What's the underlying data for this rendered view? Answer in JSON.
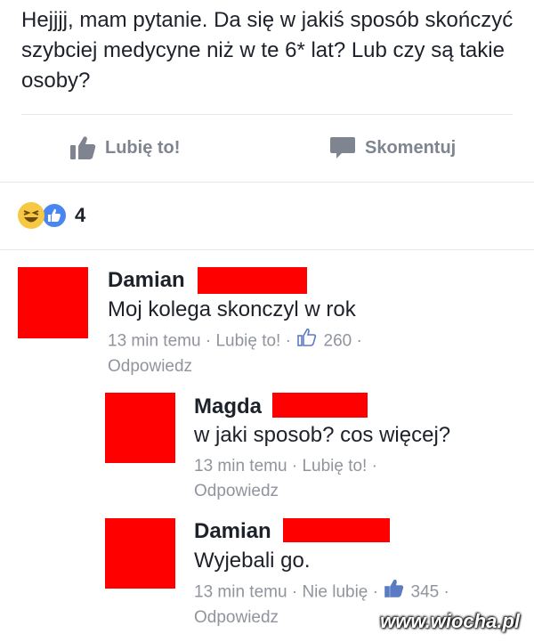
{
  "post": {
    "text": "Hejjjj, mam pytanie. Da się w jakiś sposób skończyć szybciej medycyne niż w te 6* lat? Lub czy są takie osoby?"
  },
  "actions": {
    "like_label": "Lubię to!",
    "comment_label": "Skomentuj",
    "like_icon": "thumbs-up-icon",
    "comment_icon": "speech-bubble-icon"
  },
  "reactions": {
    "count": "4",
    "icons": [
      "haha-emoji-icon",
      "like-reaction-icon"
    ]
  },
  "comments": [
    {
      "author": "Damian",
      "text": "Moj kolega skonczyl w rok",
      "time": "13 min temu",
      "sep": "·",
      "action": "Lubię to!",
      "likes": "260",
      "reply": "Odpowiedz"
    },
    {
      "author": "Magda",
      "text": "w jaki sposob? cos więcej?",
      "time": "13 min temu",
      "sep": "·",
      "action": "Lubię to!",
      "reply": "Odpowiedz"
    },
    {
      "author": "Damian",
      "text": "Wyjebali go.",
      "time": "13 min temu",
      "sep": "·",
      "action": "Nie lubię",
      "likes": "345",
      "reply": "Odpowiedz"
    }
  ],
  "colors": {
    "redaction": "#ff0000",
    "meta_gray": "#90949c",
    "like_blue": "#4a86f0"
  },
  "watermark": "www.wiocha.pl"
}
